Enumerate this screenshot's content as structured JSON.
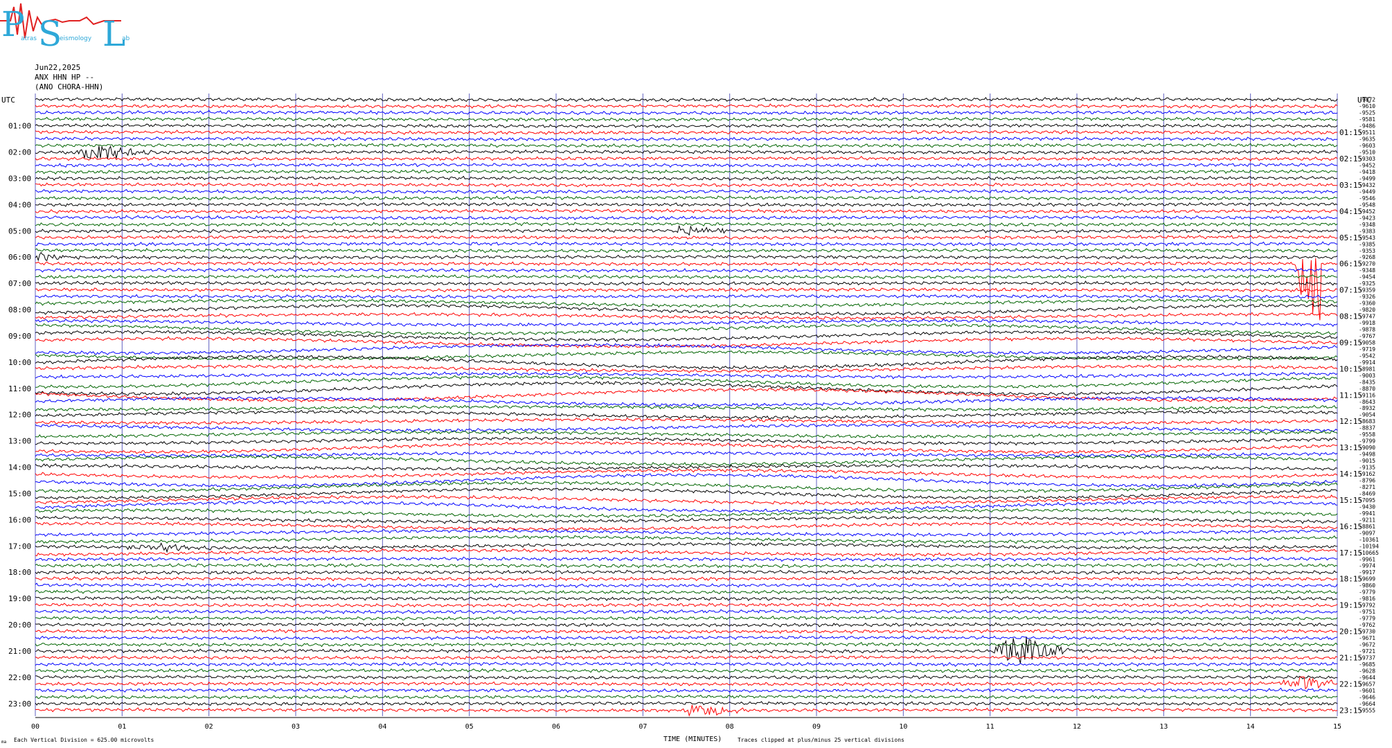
{
  "logo": {
    "big_p": "P",
    "big_s": "S",
    "big_l": "L",
    "small_1": "atras",
    "small_2": "eismology",
    "small_3": "ab",
    "color": "#2ea8d8",
    "trace_color": "#e02020"
  },
  "header": {
    "date": "Jun22,2025",
    "station": "ANX HHN HP --",
    "location": "(ANO CHORA-HHN)"
  },
  "axis": {
    "left_utc": "UTC",
    "right_utc": "UTC",
    "xlabel": "TIME (MINUTES)"
  },
  "footer": {
    "scale_note": "Each Vertical Division = 625.00 microvolts",
    "clip_note": "Traces clipped at plus/minus 25 vertical divisions",
    "corner_mark": "ma"
  },
  "colors": {
    "black": "#000000",
    "red": "#ff0000",
    "blue": "#0000ff",
    "green": "#006400",
    "grid": "#6060c0"
  },
  "chart_data": {
    "type": "line",
    "title": "Jun22,2025 ANX HHN HP -- (ANO CHORA-HHN)",
    "xlabel": "TIME (MINUTES)",
    "xlim": [
      0,
      15
    ],
    "x_ticks": [
      "00",
      "01",
      "02",
      "03",
      "04",
      "05",
      "06",
      "07",
      "08",
      "09",
      "10",
      "11",
      "12",
      "13",
      "14",
      "15"
    ],
    "left_hour_labels": [
      "01:00",
      "02:00",
      "03:00",
      "04:00",
      "05:00",
      "06:00",
      "07:00",
      "08:00",
      "09:00",
      "10:00",
      "11:00",
      "12:00",
      "13:00",
      "14:00",
      "15:00",
      "16:00",
      "17:00",
      "18:00",
      "19:00",
      "20:00",
      "21:00",
      "22:00",
      "23:00"
    ],
    "right_hour_labels": [
      "01:15",
      "02:15",
      "03:15",
      "04:15",
      "05:15",
      "06:15",
      "07:15",
      "08:15",
      "09:15",
      "10:15",
      "11:15",
      "12:15",
      "13:15",
      "14:15",
      "15:15",
      "16:15",
      "17:15",
      "18:15",
      "19:15",
      "20:15",
      "21:15",
      "22:15",
      "23:15"
    ],
    "traces_per_hour": 4,
    "trace_color_cycle": [
      "black",
      "red",
      "blue",
      "green"
    ],
    "right_offsets": [
      "-9872",
      "-9610",
      "-9525",
      "-9581",
      "-9486",
      "-9511",
      "-9635",
      "-9603",
      "-9510",
      "-9303",
      "-9452",
      "-9418",
      "-9499",
      "-9432",
      "-9449",
      "-9546",
      "-9548",
      "-9452",
      "-9423",
      "-9348",
      "-9383",
      "-9543",
      "-9385",
      "-9353",
      "-9268",
      "-9270",
      "-9348",
      "-9454",
      "-9325",
      "-9359",
      "-9326",
      "-9360",
      "-9820",
      "-9747",
      "-9918",
      "-9878",
      "-9767",
      "-9058",
      "-9719",
      "-9542",
      "-9914",
      "-8981",
      "-9003",
      "-8435",
      "-8870",
      "-9116",
      "-8643",
      "-8932",
      "-9054",
      "-8683",
      "-8837",
      "-9558",
      "-9799",
      "-9090",
      "-9498",
      "-9015",
      "-9135",
      "-9162",
      "-8796",
      "-8271",
      "-8469",
      "-7095",
      "-9430",
      "-9941",
      "-9211",
      "-8861",
      "-9097",
      "-10361",
      "-10194",
      "-10665",
      "-9961",
      "-9974",
      "-9917",
      "-9699",
      "-9860",
      "-9779",
      "-9816",
      "-9792",
      "-9751",
      "-9779",
      "-9762",
      "-9730",
      "-9671",
      "-9672",
      "-9721",
      "-9737",
      "-9685",
      "-9628",
      "-9644",
      "-9657",
      "-9601",
      "-9646",
      "-9664",
      "-9555"
    ],
    "events": [
      {
        "trace_hour": "02:00",
        "minute_start": 0.4,
        "minute_peak": 0.7,
        "duration_min": 1.8,
        "amplitude_div": 3.5,
        "color": "black"
      },
      {
        "trace_hour": "05:00",
        "minute_start": 7.35,
        "minute_peak": 7.45,
        "duration_min": 0.6,
        "amplitude_div": 1.8,
        "color": "black"
      },
      {
        "trace_hour": "06:00",
        "minute_start": 0.0,
        "minute_peak": 0.05,
        "duration_min": 0.9,
        "amplitude_div": 1.5,
        "color": "blue"
      },
      {
        "trace_hour": "06:15",
        "minute_start": 14.5,
        "minute_peak": 14.7,
        "duration_min": 0.3,
        "amplitude_div": 25,
        "color": "red"
      },
      {
        "trace_hour": "17:00",
        "minute_start": 1.0,
        "minute_peak": 1.5,
        "duration_min": 1.6,
        "amplitude_div": 1.2,
        "color": "red"
      },
      {
        "trace_hour": "21:00",
        "minute_start": 11.0,
        "minute_peak": 11.3,
        "duration_min": 2.2,
        "amplitude_div": 6,
        "color": "green"
      },
      {
        "trace_hour": "22:15",
        "minute_start": 14.2,
        "minute_peak": 14.6,
        "duration_min": 0.8,
        "amplitude_div": 2.2,
        "color": "red"
      },
      {
        "trace_hour": "23:15",
        "minute_start": 7.45,
        "minute_peak": 7.6,
        "duration_min": 0.7,
        "amplitude_div": 2.4,
        "color": "blue"
      }
    ],
    "grid": true
  }
}
